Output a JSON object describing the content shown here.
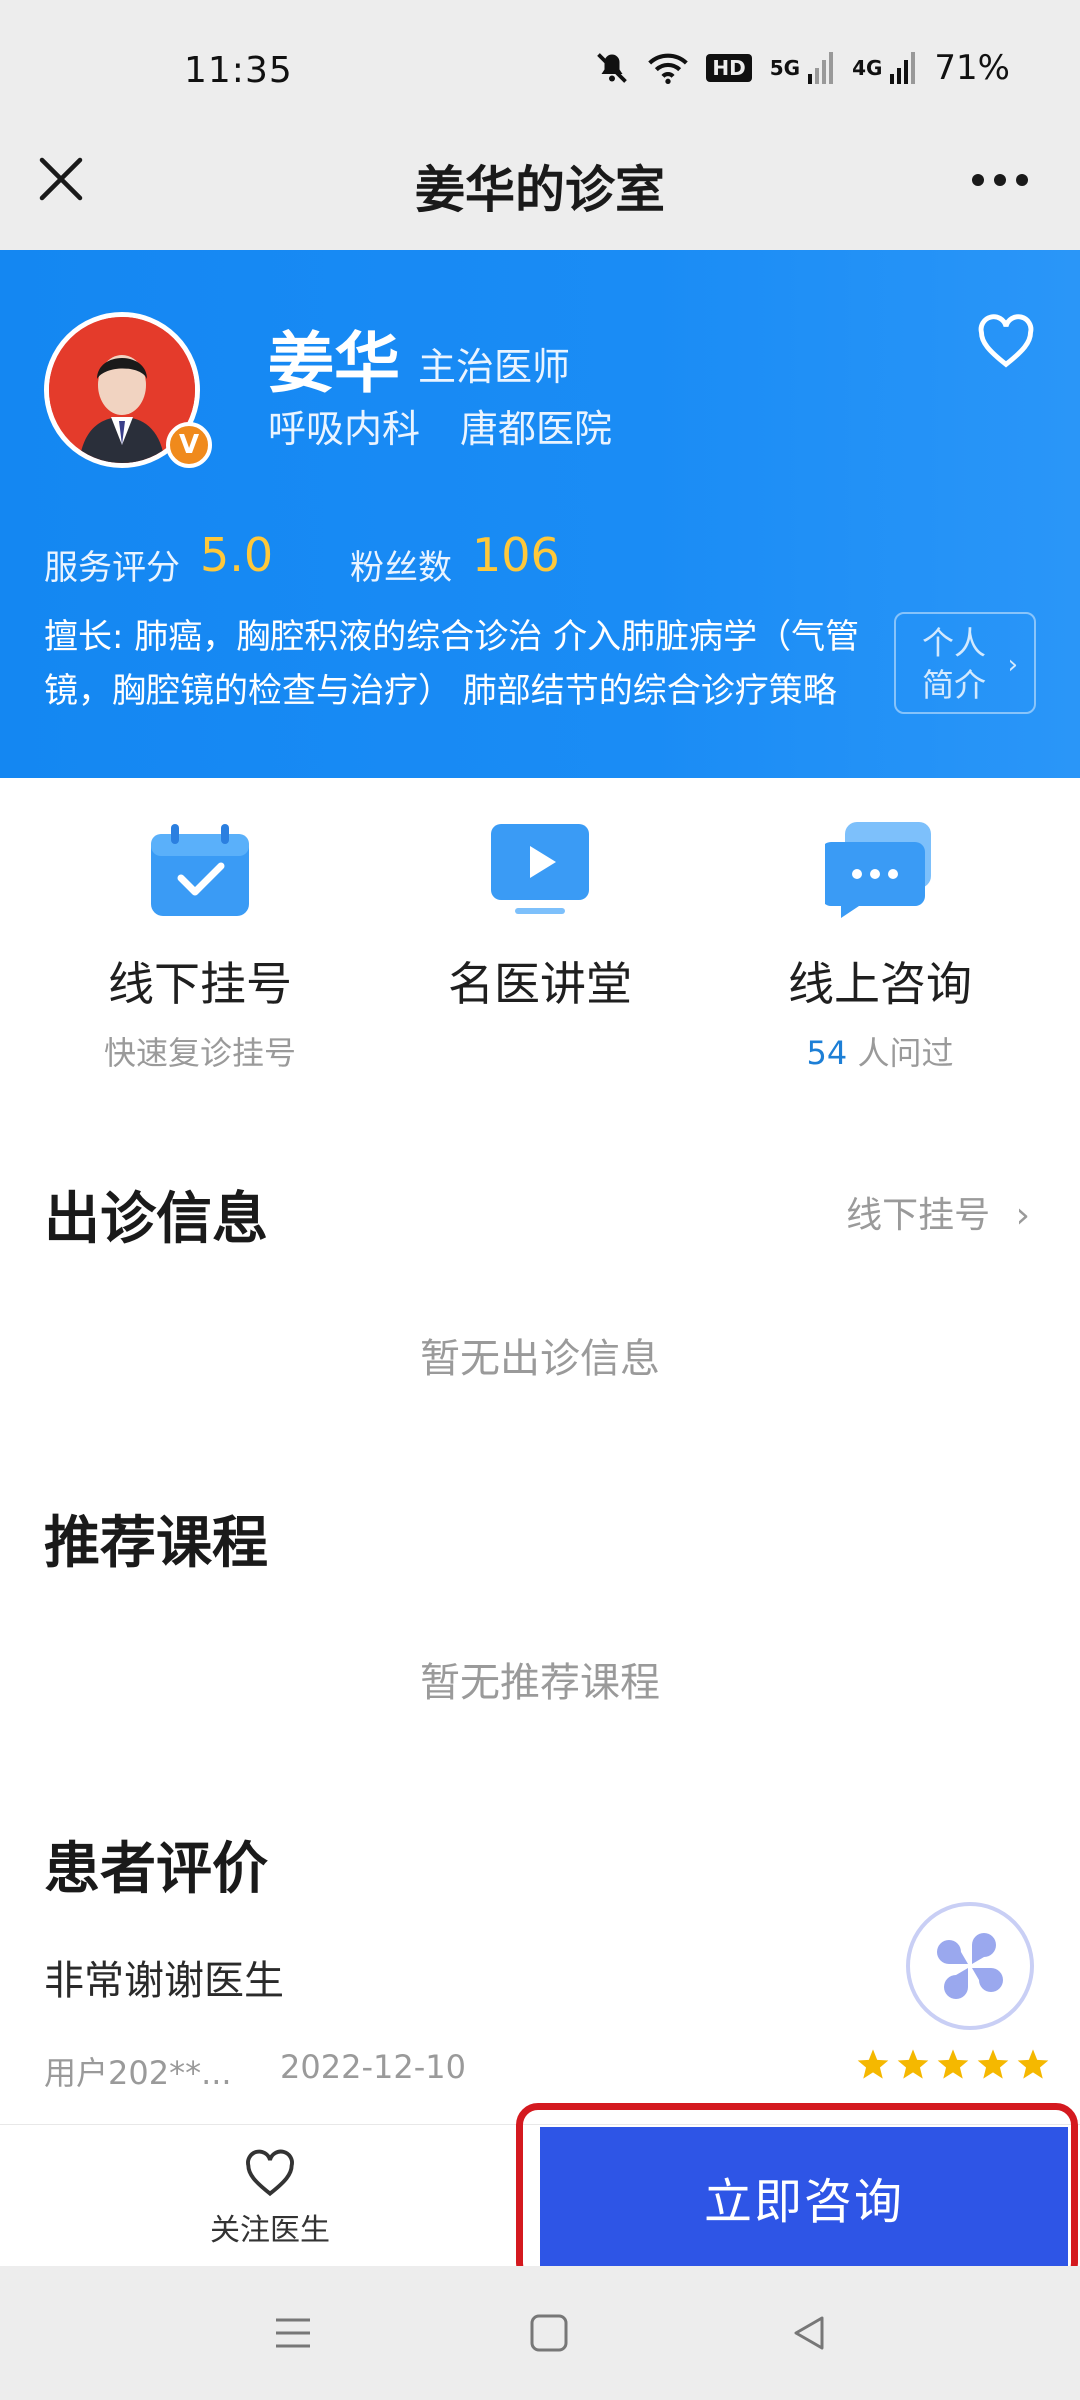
{
  "status_bar": {
    "time": "11:35",
    "hd_label": "HD",
    "net1": "5G",
    "net2": "4G",
    "battery": "71%"
  },
  "title_bar": {
    "title": "姜华的诊室"
  },
  "doctor": {
    "name": "姜华",
    "title": "主治医师",
    "department": "呼吸内科",
    "hospital": "唐都医院",
    "badge": "V",
    "rating_label": "服务评分",
    "rating_value": "5.0",
    "fans_label": "粉丝数",
    "fans_value": "106",
    "expertise": "擅长: 肺癌，胸腔积液的综合诊治 介入肺脏病学（气管镜，胸腔镜的检查与治疗） 肺部结节的综合诊疗策略",
    "profile_btn_line1": "个人",
    "profile_btn_line2": "简介"
  },
  "actions": [
    {
      "label": "线下挂号",
      "sub": "快速复诊挂号"
    },
    {
      "label": "名医讲堂",
      "sub": ""
    },
    {
      "label": "线上咨询",
      "sub_num": "54",
      "sub": " 人问过"
    }
  ],
  "schedule": {
    "title": "出诊信息",
    "link": "线下挂号",
    "empty": "暂无出诊信息"
  },
  "courses": {
    "title": "推荐课程",
    "empty": "暂无推荐课程"
  },
  "reviews": {
    "title": "患者评价",
    "items": [
      {
        "text": "非常谢谢医生",
        "user": "用户202**...",
        "date": "2022-12-10",
        "stars": 5
      }
    ]
  },
  "bottom_bar": {
    "follow_label": "关注医生",
    "consult_label": "立即咨询"
  },
  "colors": {
    "header_blue": "#1a8cf5",
    "accent_yellow": "#ffc83a",
    "consult_blue": "#2e55e6",
    "highlight_red": "#d4191f",
    "star_gold": "#f5b800"
  }
}
